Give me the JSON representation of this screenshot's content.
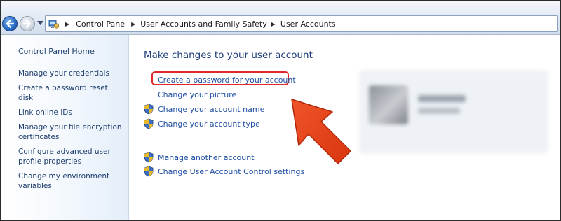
{
  "breadcrumb": {
    "items": [
      "Control Panel",
      "User Accounts and Family Safety",
      "User Accounts"
    ]
  },
  "sidebar": {
    "home": "Control Panel Home",
    "links": [
      "Manage your credentials",
      "Create a password reset disk",
      "Link online IDs",
      "Manage your file encryption certificates",
      "Configure advanced user profile properties",
      "Change my environment variables"
    ]
  },
  "main": {
    "heading": "Make changes to your user account",
    "tasks": [
      "Create a password for your account",
      "Change your picture",
      "Change your account name",
      "Change your account type",
      "Manage another account",
      "Change User Account Control settings"
    ]
  },
  "colors": {
    "link": "#1f4ea3",
    "heading": "#1e3d7a",
    "highlight_border": "#e0292a",
    "arrow": "#e6401b"
  },
  "icons": {
    "back": "back-arrow-icon",
    "forward": "forward-arrow-icon",
    "control_panel": "control-panel-icon",
    "shield": "uac-shield-icon"
  }
}
